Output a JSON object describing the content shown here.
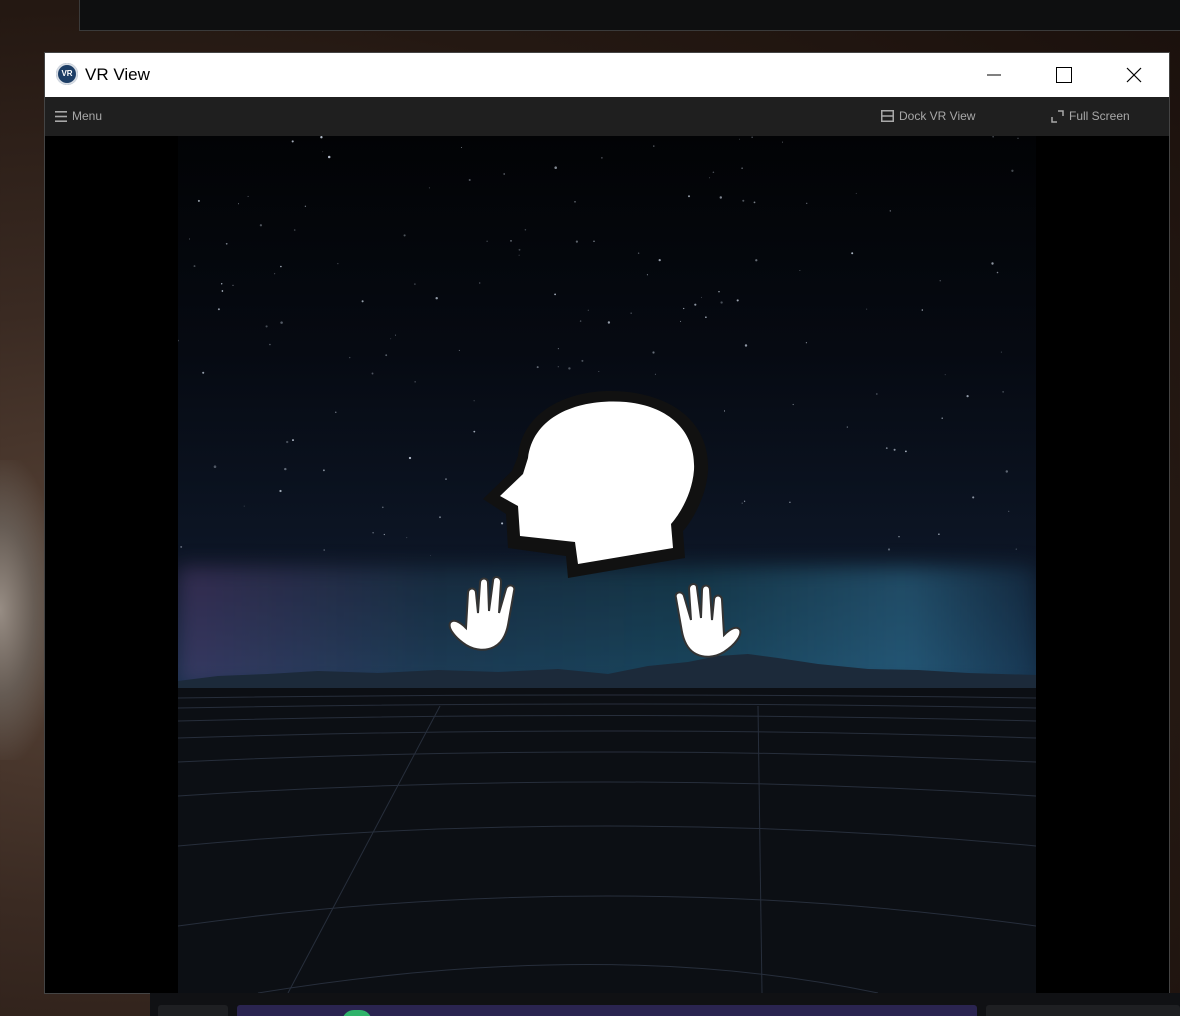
{
  "window": {
    "title": "VR View",
    "icon_label": "VR",
    "controls": {
      "minimize": "minimize-icon",
      "maximize": "maximize-icon",
      "close": "close-icon"
    }
  },
  "toolbar": {
    "menu_label": "Menu",
    "dock_label": "Dock VR View",
    "fullscreen_label": "Full Screen"
  },
  "viewport": {
    "head_icon": "head-icon",
    "left_hand_icon": "hand-icon",
    "right_hand_icon": "hand-icon"
  },
  "colors": {
    "titlebar": "#ffffff",
    "toolbar": "#1f1f1f",
    "toolbar_text": "#a8a8a8",
    "viewport_bg": "#000000"
  }
}
